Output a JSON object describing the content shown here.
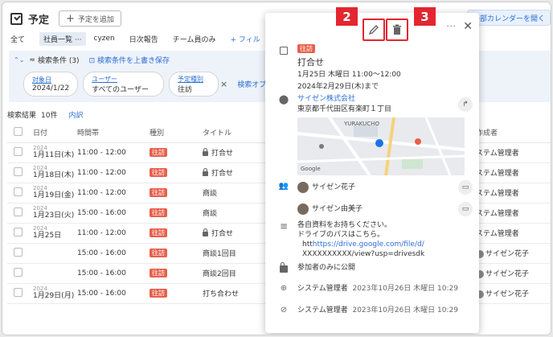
{
  "header": {
    "title": "予定",
    "add_button": "予定を追加",
    "ext_button": "外部カレンダーを開く"
  },
  "tabs": [
    "全て",
    "チーム員のみ"
  ],
  "active_tab": "社員一覧",
  "active_tab_dots": "···",
  "tab_cyzen": "cyzen",
  "tab_daily": "日次報告",
  "filter_label": "フィル",
  "search": {
    "label": "検索条件 (3)",
    "save": "検索条件を上書き保存",
    "chip1_ph": "対象日",
    "chip1_val": "2024/1/22",
    "chip2_ph": "ユーザー",
    "chip2_val": "すべてのユーザー",
    "chip3_ph": "予定種別",
    "chip3_val": "往訪",
    "options": "検索オプショ"
  },
  "results": {
    "label": "検索結果",
    "count": "10件",
    "breakdown": "内訳"
  },
  "table": {
    "headers": [
      "日付",
      "時間帯",
      "種別",
      "タイトル",
      "作成者"
    ],
    "rows": [
      {
        "year": "2024",
        "date": "1月11日(木)",
        "time": "11:00 - 12:00",
        "type": "往訪",
        "title": "打合せ",
        "locked": true,
        "creator": "ステム管理者"
      },
      {
        "year": "2024",
        "date": "1月18日(木)",
        "time": "11:00 - 12:00",
        "type": "往訪",
        "title": "打合せ",
        "locked": true,
        "creator": "ステム管理者"
      },
      {
        "year": "2024",
        "date": "1月19日(金)",
        "time": "11:00 - 12:00",
        "type": "往訪",
        "title": "商談",
        "locked": false,
        "creator": "ステム管理者"
      },
      {
        "year": "2024",
        "date": "1月23日(火)",
        "time": "15:00 - 16:00",
        "type": "往訪",
        "title": "商談",
        "locked": false,
        "creator": "ステム管理者"
      },
      {
        "year": "2024",
        "date": "1月25日",
        "time": "11:00 - 12:00",
        "type": "往訪",
        "title": "打合せ",
        "locked": true,
        "creator": "ステム管理者"
      },
      {
        "year": "",
        "date": "",
        "time": "15:00 - 16:00",
        "type": "往訪",
        "title": "商談1回目",
        "locked": false,
        "creator": "サイゼン花子"
      },
      {
        "year": "",
        "date": "",
        "time": "15:00 - 16:00",
        "type": "往訪",
        "title": "商談2回目",
        "locked": false,
        "creator": "サイゼン花子"
      },
      {
        "year": "2024",
        "date": "1月29日(月)",
        "time": "15:00 - 16:00",
        "type": "往訪",
        "title": "打ち合わせ",
        "locked": false,
        "creator": "サイゼン花子"
      }
    ]
  },
  "popup": {
    "tag": "往訪",
    "title": "打合せ",
    "datetime": "1月25日 木曜日 11:00～12:00",
    "repeat": "2024年2月29日(木)まで",
    "company": "サイゼン株式会社",
    "address": "東京都千代田区有楽町１丁目",
    "map_label1": "YURAKUCHO",
    "map_label2": "Google",
    "participant1": "サイゼン花子",
    "participant2": "サイゼン由美子",
    "memo1": "各自資料をお持ちください。",
    "memo2": "ドライブのパスはこちら。",
    "memo3_prefix": "htt",
    "memo3_link": "https://drive.google.com/file/d/",
    "memo4": "XXXXXXXXXX/view?usp=drivesdk",
    "visibility": "参加者のみに公開",
    "created_by": "システム管理者",
    "created_at": "2023年10月26日 木曜日 10:29",
    "updated_by": "システム管理者",
    "updated_at": "2023年10月26日 木曜日 10:29",
    "callout_edit": "2",
    "callout_delete": "3"
  },
  "colors": {
    "accent": "#2a6fd6",
    "tag": "#e8604c",
    "callout": "#e3262f"
  }
}
